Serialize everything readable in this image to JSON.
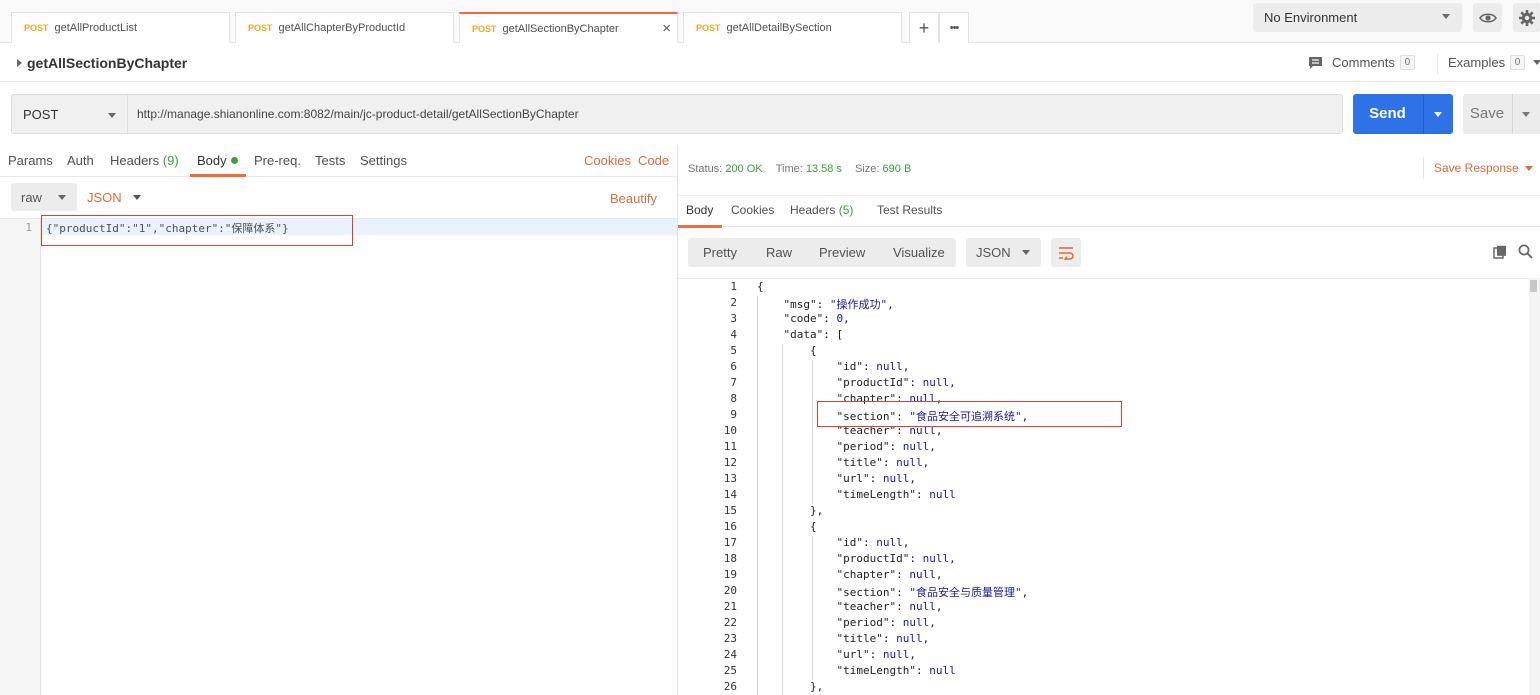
{
  "tabs": [
    {
      "method": "POST",
      "name": "getAllProductList"
    },
    {
      "method": "POST",
      "name": "getAllChapterByProductId"
    },
    {
      "method": "POST",
      "name": "getAllSectionByChapter"
    },
    {
      "method": "POST",
      "name": "getAllDetailBySection"
    }
  ],
  "tabbar": {
    "add": "+",
    "more": "•••",
    "close": "×"
  },
  "environment": {
    "selected": "No Environment"
  },
  "request": {
    "name": "getAllSectionByChapter",
    "comments_label": "Comments",
    "comments_count": "0",
    "examples_label": "Examples",
    "examples_count": "0",
    "method": "POST",
    "url": "http://manage.shianonline.com:8082/main/jc-product-detail/getAllSectionByChapter",
    "send_label": "Send",
    "save_label": "Save"
  },
  "request_tabs": {
    "params": "Params",
    "auth": "Auth",
    "headers": "Headers",
    "headers_count": "(9)",
    "body": "Body",
    "prereq": "Pre-req.",
    "tests": "Tests",
    "settings": "Settings",
    "cookies": "Cookies",
    "code": "Code"
  },
  "body_options": {
    "mode": "raw",
    "format": "JSON",
    "beautify": "Beautify"
  },
  "request_body": {
    "line_number": "1",
    "text": "{\"productId\":\"1\",\"chapter\":\"保障体系\"}"
  },
  "response": {
    "status_label": "Status:",
    "status_value": "200 OK",
    "time_label": "Time:",
    "time_value": "13.58 s",
    "size_label": "Size:",
    "size_value": "690 B",
    "save_response": "Save Response",
    "tabs": {
      "body": "Body",
      "cookies": "Cookies",
      "headers": "Headers",
      "headers_count": "(5)",
      "test_results": "Test Results"
    },
    "views": [
      "Pretty",
      "Raw",
      "Preview",
      "Visualize"
    ],
    "format": "JSON",
    "lines": [
      [
        {
          "t": "p",
          "v": "{"
        }
      ],
      [
        {
          "t": "k",
          "v": "    \"msg\""
        },
        {
          "t": "p",
          "v": ": "
        },
        {
          "t": "s",
          "v": "\"操作成功\""
        },
        {
          "t": "p",
          "v": ","
        }
      ],
      [
        {
          "t": "k",
          "v": "    \"code\""
        },
        {
          "t": "p",
          "v": ": "
        },
        {
          "t": "num",
          "v": "0"
        },
        {
          "t": "p",
          "v": ","
        }
      ],
      [
        {
          "t": "k",
          "v": "    \"data\""
        },
        {
          "t": "p",
          "v": ": ["
        }
      ],
      [
        {
          "t": "p",
          "v": "        {"
        }
      ],
      [
        {
          "t": "k",
          "v": "            \"id\""
        },
        {
          "t": "p",
          "v": ": "
        },
        {
          "t": "nl",
          "v": "null"
        },
        {
          "t": "p",
          "v": ","
        }
      ],
      [
        {
          "t": "k",
          "v": "            \"productId\""
        },
        {
          "t": "p",
          "v": ": "
        },
        {
          "t": "nl",
          "v": "null"
        },
        {
          "t": "p",
          "v": ","
        }
      ],
      [
        {
          "t": "k",
          "v": "            \"chapter\""
        },
        {
          "t": "p",
          "v": ": "
        },
        {
          "t": "nl",
          "v": "null"
        },
        {
          "t": "p",
          "v": ","
        }
      ],
      [
        {
          "t": "k",
          "v": "            \"section\""
        },
        {
          "t": "p",
          "v": ": "
        },
        {
          "t": "s",
          "v": "\"食品安全可追溯系统\""
        },
        {
          "t": "p",
          "v": ","
        }
      ],
      [
        {
          "t": "k",
          "v": "            \"teacher\""
        },
        {
          "t": "p",
          "v": ": "
        },
        {
          "t": "nl",
          "v": "null"
        },
        {
          "t": "p",
          "v": ","
        }
      ],
      [
        {
          "t": "k",
          "v": "            \"period\""
        },
        {
          "t": "p",
          "v": ": "
        },
        {
          "t": "nl",
          "v": "null"
        },
        {
          "t": "p",
          "v": ","
        }
      ],
      [
        {
          "t": "k",
          "v": "            \"title\""
        },
        {
          "t": "p",
          "v": ": "
        },
        {
          "t": "nl",
          "v": "null"
        },
        {
          "t": "p",
          "v": ","
        }
      ],
      [
        {
          "t": "k",
          "v": "            \"url\""
        },
        {
          "t": "p",
          "v": ": "
        },
        {
          "t": "nl",
          "v": "null"
        },
        {
          "t": "p",
          "v": ","
        }
      ],
      [
        {
          "t": "k",
          "v": "            \"timeLength\""
        },
        {
          "t": "p",
          "v": ": "
        },
        {
          "t": "nl",
          "v": "null"
        }
      ],
      [
        {
          "t": "p",
          "v": "        },"
        }
      ],
      [
        {
          "t": "p",
          "v": "        {"
        }
      ],
      [
        {
          "t": "k",
          "v": "            \"id\""
        },
        {
          "t": "p",
          "v": ": "
        },
        {
          "t": "nl",
          "v": "null"
        },
        {
          "t": "p",
          "v": ","
        }
      ],
      [
        {
          "t": "k",
          "v": "            \"productId\""
        },
        {
          "t": "p",
          "v": ": "
        },
        {
          "t": "nl",
          "v": "null"
        },
        {
          "t": "p",
          "v": ","
        }
      ],
      [
        {
          "t": "k",
          "v": "            \"chapter\""
        },
        {
          "t": "p",
          "v": ": "
        },
        {
          "t": "nl",
          "v": "null"
        },
        {
          "t": "p",
          "v": ","
        }
      ],
      [
        {
          "t": "k",
          "v": "            \"section\""
        },
        {
          "t": "p",
          "v": ": "
        },
        {
          "t": "s",
          "v": "\"食品安全与质量管理\""
        },
        {
          "t": "p",
          "v": ","
        }
      ],
      [
        {
          "t": "k",
          "v": "            \"teacher\""
        },
        {
          "t": "p",
          "v": ": "
        },
        {
          "t": "nl",
          "v": "null"
        },
        {
          "t": "p",
          "v": ","
        }
      ],
      [
        {
          "t": "k",
          "v": "            \"period\""
        },
        {
          "t": "p",
          "v": ": "
        },
        {
          "t": "nl",
          "v": "null"
        },
        {
          "t": "p",
          "v": ","
        }
      ],
      [
        {
          "t": "k",
          "v": "            \"title\""
        },
        {
          "t": "p",
          "v": ": "
        },
        {
          "t": "nl",
          "v": "null"
        },
        {
          "t": "p",
          "v": ","
        }
      ],
      [
        {
          "t": "k",
          "v": "            \"url\""
        },
        {
          "t": "p",
          "v": ": "
        },
        {
          "t": "nl",
          "v": "null"
        },
        {
          "t": "p",
          "v": ","
        }
      ],
      [
        {
          "t": "k",
          "v": "            \"timeLength\""
        },
        {
          "t": "p",
          "v": ": "
        },
        {
          "t": "nl",
          "v": "null"
        }
      ],
      [
        {
          "t": "p",
          "v": "        },"
        }
      ]
    ]
  },
  "colors": {
    "accent": "#f26b3a",
    "send": "#2f72e8",
    "status_ok": "#3c9f40",
    "method": "#f5a623",
    "highlight_box": "#d9412f"
  }
}
